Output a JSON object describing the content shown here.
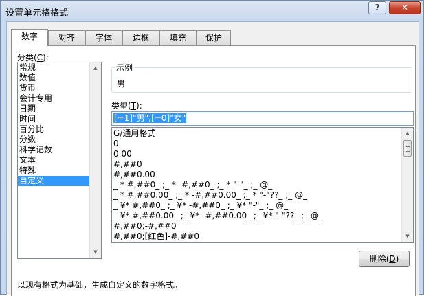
{
  "window": {
    "title": "设置单元格格式",
    "help_label": "?",
    "close_label": "✕"
  },
  "tabs": [
    {
      "label": "数字",
      "active": true
    },
    {
      "label": "对齐"
    },
    {
      "label": "字体"
    },
    {
      "label": "边框"
    },
    {
      "label": "填充"
    },
    {
      "label": "保护"
    }
  ],
  "category": {
    "label_text": "分类(",
    "label_key": "C",
    "label_end": "):",
    "items": [
      "常规",
      "数值",
      "货币",
      "会计专用",
      "日期",
      "时间",
      "百分比",
      "分数",
      "科学记数",
      "文本",
      "特殊",
      "自定义"
    ],
    "selected": "自定义"
  },
  "sample": {
    "legend": "示例",
    "value": "男"
  },
  "type": {
    "label_text": "类型(",
    "label_key": "T",
    "label_end": "):",
    "value": "[=1]\"男\";[=0]\"女\""
  },
  "formats": [
    "G/通用格式",
    "0",
    "0.00",
    "#,##0",
    "#,##0.00",
    "_ * #,##0_ ;_ * -#,##0_ ;_ * \"-\"_ ;_ @_",
    "_ * #,##0.00_ ;_ * -#,##0.00_ ;_ * \"-\"??_ ;_ @_",
    "_ ¥* #,##0_ ;_ ¥* -#,##0_ ;_ ¥* \"-\"_ ;_ @_",
    "_ ¥* #,##0.00_ ;_ ¥* -#,##0.00_ ;_ ¥* \"-\"??_ ;_ @_",
    "#,##0;-#,##0",
    "#,##0;[红色]-#,##0"
  ],
  "delete_button": {
    "label_text": "删除(",
    "label_key": "D",
    "label_end": ")"
  },
  "description": "以现有格式为基础，生成自定义的数字格式。"
}
